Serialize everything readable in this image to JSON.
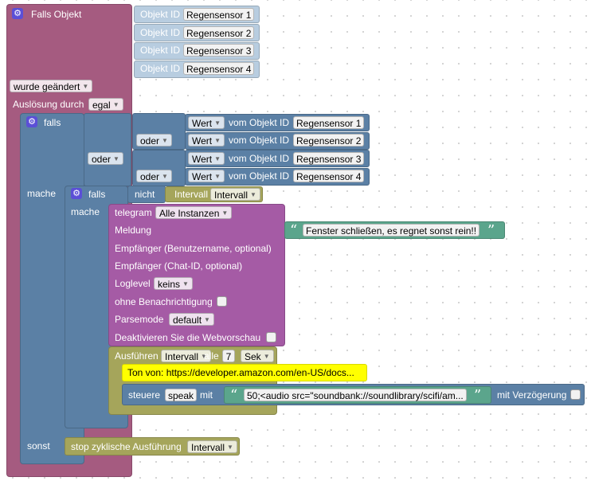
{
  "colors": {
    "event": "#a55b80",
    "logic": "#5b80a5",
    "loop": "#a5a55b",
    "string": "#5ba58c",
    "telegram": "#a55ba5",
    "yellow": "#ffff00",
    "sensor": "#b8cde0"
  },
  "event_block": {
    "title": "Falls Objekt",
    "object_label": "Objekt ID",
    "sensors": [
      "Regensensor 1",
      "Regensensor 2",
      "Regensensor 3",
      "Regensensor 4"
    ],
    "changed_dropdown": "wurde geändert",
    "trigger_label": "Auslösung durch",
    "trigger_value": "egal"
  },
  "if_block": {
    "falls": "falls",
    "mache": "mache",
    "sonst": "sonst",
    "oder": "oder",
    "wert": "Wert",
    "vom_objekt": "vom Objekt ID",
    "sensors": [
      "Regensensor 1",
      "Regensensor 2",
      "Regensensor 3",
      "Regensensor 4"
    ]
  },
  "inner_if": {
    "falls": "falls",
    "mache": "mache",
    "nicht": "nicht",
    "interval_label": "Intervall",
    "interval_value": "Intervall"
  },
  "telegram": {
    "title": "telegram",
    "instance": "Alle Instanzen",
    "meldung": "Meldung",
    "message": "Fenster schließen, es regnet sonst rein!!",
    "recipient_user": "Empfänger (Benutzername, optional)",
    "recipient_chat": "Empfänger (Chat-ID, optional)",
    "loglevel_label": "Loglevel",
    "loglevel_value": "keins",
    "silent": "ohne Benachrichtigung",
    "parsemode_label": "Parsemode",
    "parsemode_value": "default",
    "webpreview": "Deaktivieren Sie die Webvorschau"
  },
  "interval_block": {
    "ausfuehren": "Ausführen",
    "var": "Intervall",
    "alle": "alle",
    "count": "7",
    "unit": "Sek"
  },
  "comment": {
    "text": "Ton von: https://developer.amazon.com/en-US/docs..."
  },
  "control": {
    "label": "steuere",
    "target": "speak",
    "mit": "mit",
    "value": "50;<audio src=\"soundbank://soundlibrary/scifi/am...",
    "delay": "mit Verzögerung"
  },
  "stop": {
    "label": "stop zyklische Ausführung",
    "var": "Intervall"
  }
}
